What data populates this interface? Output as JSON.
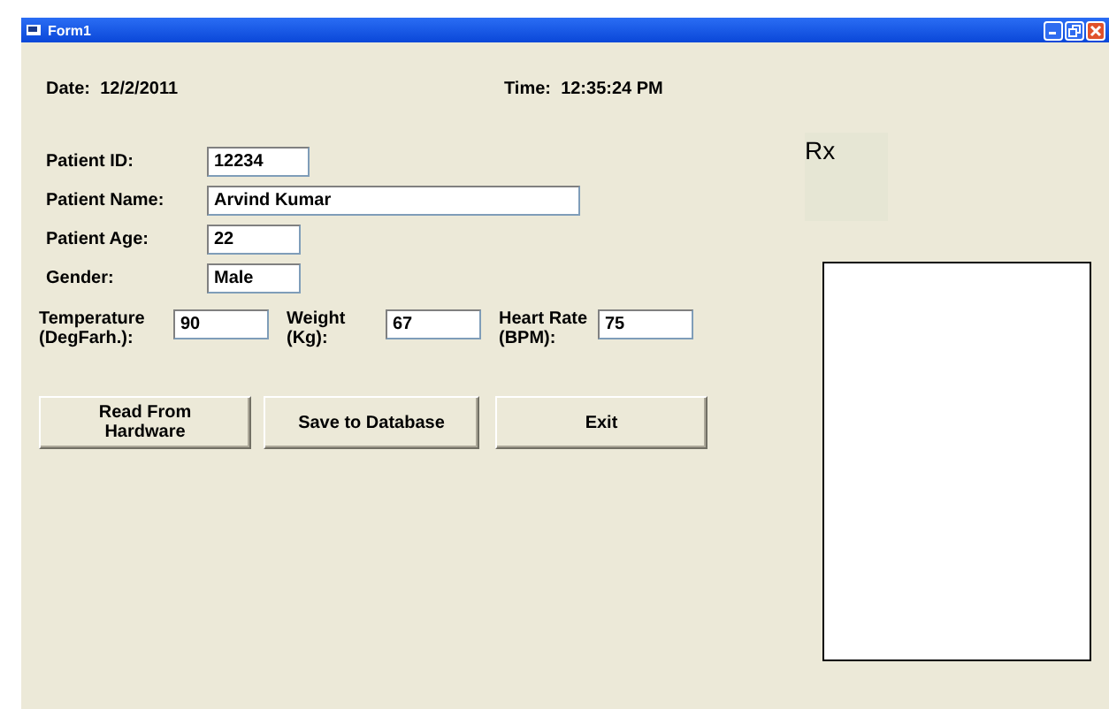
{
  "window": {
    "title": "Form1"
  },
  "date": {
    "label": "Date:",
    "value": "12/2/2011"
  },
  "time": {
    "label": "Time:",
    "value": "12:35:24 PM"
  },
  "fields": [
    {
      "label": "Patient ID:",
      "value": "12234"
    },
    {
      "label": "Patient Name:",
      "value": "Arvind Kumar"
    },
    {
      "label": "Patient Age:",
      "value": "22"
    },
    {
      "label": "Gender:",
      "value": "Male"
    }
  ],
  "vitals": [
    {
      "label": "Temperature\n(DegFarh.):",
      "value": "90"
    },
    {
      "label": "Weight\n(Kg):",
      "value": "67"
    },
    {
      "label": "Heart Rate\n(BPM):",
      "value": "75"
    }
  ],
  "buttons": [
    "Read From\nHardware",
    "Save to Database",
    "Exit"
  ],
  "rx_label": "Rx"
}
